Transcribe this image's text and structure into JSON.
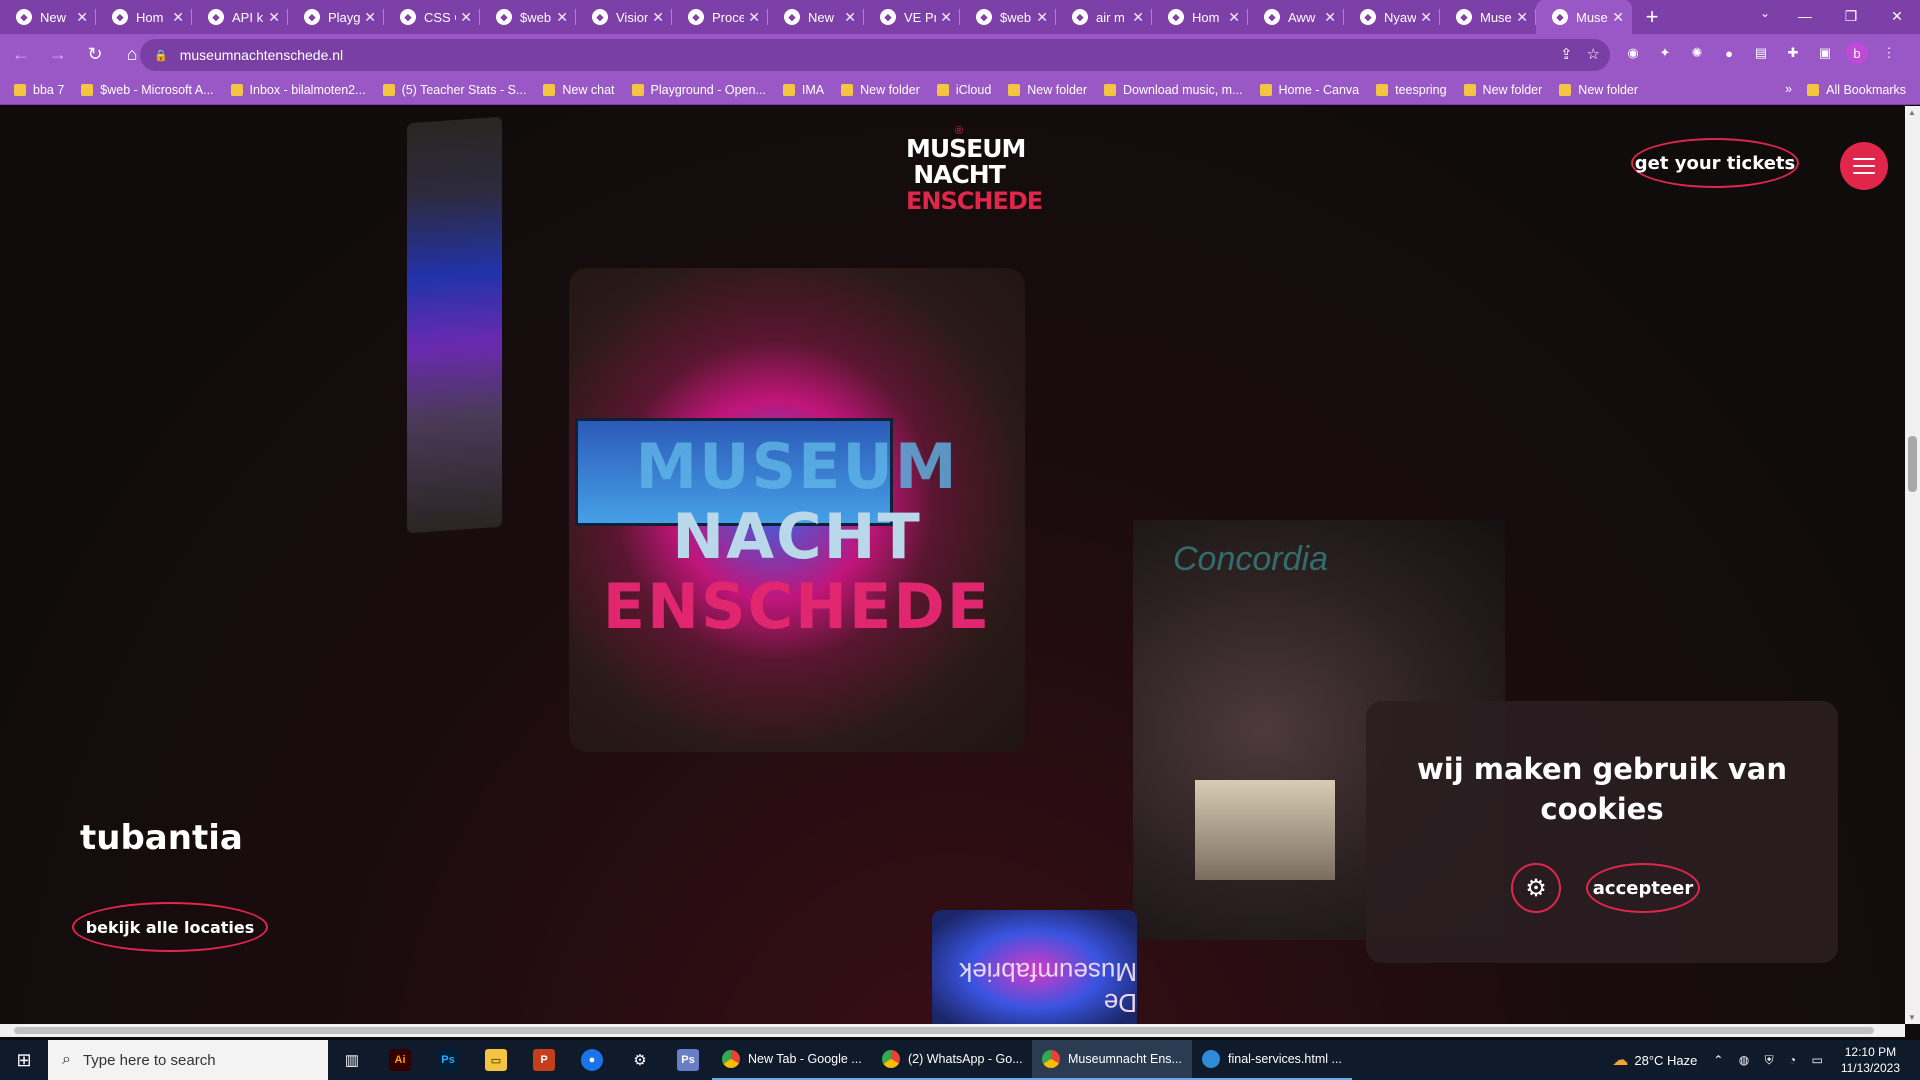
{
  "browser": {
    "tabs": [
      {
        "title": "New",
        "icon": "chatgpt-icon"
      },
      {
        "title": "Hom",
        "icon": "brush-icon"
      },
      {
        "title": "API k",
        "icon": "openai-icon"
      },
      {
        "title": "Playg",
        "icon": "openai-icon"
      },
      {
        "title": "CSS C",
        "icon": "css-icon"
      },
      {
        "title": "$web",
        "icon": "azure-icon"
      },
      {
        "title": "Vision",
        "icon": "openai-icon"
      },
      {
        "title": "Proce",
        "icon": "page-icon"
      },
      {
        "title": "New",
        "icon": "page-icon"
      },
      {
        "title": "VE Pr",
        "icon": "ve-icon"
      },
      {
        "title": "$web",
        "icon": "azure-icon"
      },
      {
        "title": "air m",
        "icon": "google-icon"
      },
      {
        "title": "Hom",
        "icon": "brush-icon"
      },
      {
        "title": "Aww",
        "icon": "w-icon"
      },
      {
        "title": "Nyaw",
        "icon": "w-icon"
      },
      {
        "title": "Muse",
        "icon": "w-icon"
      },
      {
        "title": "Muse",
        "icon": "museum-icon",
        "active": true
      }
    ],
    "url": "museumnachtenschede.nl",
    "bookmarks": [
      "bba 7",
      "$web - Microsoft A...",
      "Inbox - bilalmoten2...",
      "(5) Teacher Stats - S...",
      "New chat",
      "Playground - Open...",
      "IMA",
      "New folder",
      "iCloud",
      "New folder",
      "Download music, m...",
      "Home - Canva",
      "teespring",
      "New folder",
      "New folder"
    ],
    "bookmarks_more": "»",
    "all_bookmarks": "All Bookmarks"
  },
  "site": {
    "logo": {
      "line1": "MUSEUM",
      "line2": "NACHT",
      "line3": "ENSCHEDE"
    },
    "tickets_label": "get your tickets",
    "location_name": "tubantia",
    "locations_label": "bekijk alle locaties",
    "cookie": {
      "title": "wij maken gebruik van cookies",
      "accept_label": "accepteer"
    },
    "photo_center_text": {
      "line1": "MUSEUM",
      "line2": "NACHT",
      "line3": "ENSCHEDE"
    },
    "photo_right_text": "Concordia",
    "photo_bottom_text": "De Museumfabriek",
    "accent_color": "#e0264a"
  },
  "taskbar": {
    "search_placeholder": "Type here to search",
    "apps": [
      {
        "label": "New Tab - Google ...",
        "icon": "chrome-icon"
      },
      {
        "label": "(2) WhatsApp - Go...",
        "icon": "chrome-icon"
      },
      {
        "label": "Museumnacht Ens...",
        "icon": "chrome-icon",
        "active": true
      },
      {
        "label": "final-services.html ...",
        "icon": "vscode-icon"
      }
    ],
    "weather": "28°C  Haze",
    "time": "12:10 PM",
    "date": "11/13/2023"
  }
}
